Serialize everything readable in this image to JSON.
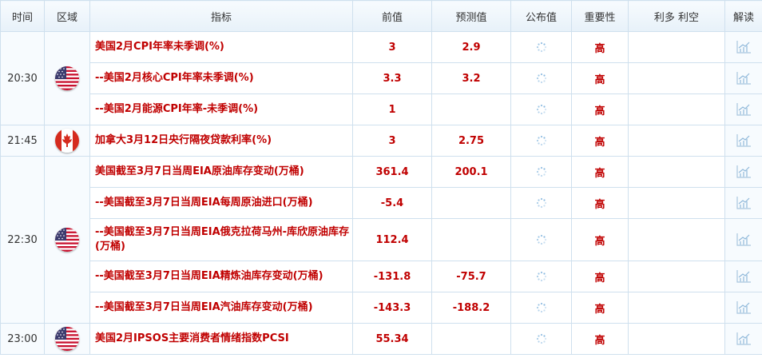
{
  "headers": {
    "time": "时间",
    "region": "区域",
    "indicator": "指标",
    "previous": "前值",
    "forecast": "预测值",
    "published": "公布值",
    "importance": "重要性",
    "impact": "利多 利空",
    "interpret": "解读"
  },
  "groups": [
    {
      "time": "20:30",
      "flag": "us-flag"
    },
    {
      "time": "21:45",
      "flag": "canada-flag"
    },
    {
      "time": "22:30",
      "flag": "us-flag"
    },
    {
      "time": "23:00",
      "flag": "us-flag"
    }
  ],
  "rows": [
    {
      "indicator": "美国2月CPI年率未季调(%)",
      "previous": "3",
      "forecast": "2.9",
      "importance": "高"
    },
    {
      "indicator": "--美国2月核心CPI年率未季调(%)",
      "previous": "3.3",
      "forecast": "3.2",
      "importance": "高"
    },
    {
      "indicator": "--美国2月能源CPI年率-未季调(%)",
      "previous": "1",
      "forecast": "",
      "importance": "高"
    },
    {
      "indicator": "加拿大3月12日央行隔夜贷款利率(%)",
      "previous": "3",
      "forecast": "2.75",
      "importance": "高"
    },
    {
      "indicator": "美国截至3月7日当周EIA原油库存变动(万桶)",
      "previous": "361.4",
      "forecast": "200.1",
      "importance": "高"
    },
    {
      "indicator": "--美国截至3月7日当周EIA每周原油进口(万桶)",
      "previous": "-5.4",
      "forecast": "",
      "importance": "高"
    },
    {
      "indicator": "--美国截至3月7日当周EIA俄克拉荷马州-库欣原油库存(万桶)",
      "previous": "112.4",
      "forecast": "",
      "importance": "高"
    },
    {
      "indicator": "--美国截至3月7日当周EIA精炼油库存变动(万桶)",
      "previous": "-131.8",
      "forecast": "-75.7",
      "importance": "高"
    },
    {
      "indicator": "--美国截至3月7日当周EIA汽油库存变动(万桶)",
      "previous": "-143.3",
      "forecast": "-188.2",
      "importance": "高"
    },
    {
      "indicator": "美国2月IPSOS主要消费者情绪指数PCSI",
      "previous": "55.34",
      "forecast": "",
      "importance": "高"
    }
  ],
  "colors": {
    "value_red": "#c00000",
    "border": "#cfe0ee",
    "header_bg": "#e7f1f9"
  },
  "icons": {
    "published": "loading-spinner-icon",
    "interpret": "chart-icon"
  }
}
